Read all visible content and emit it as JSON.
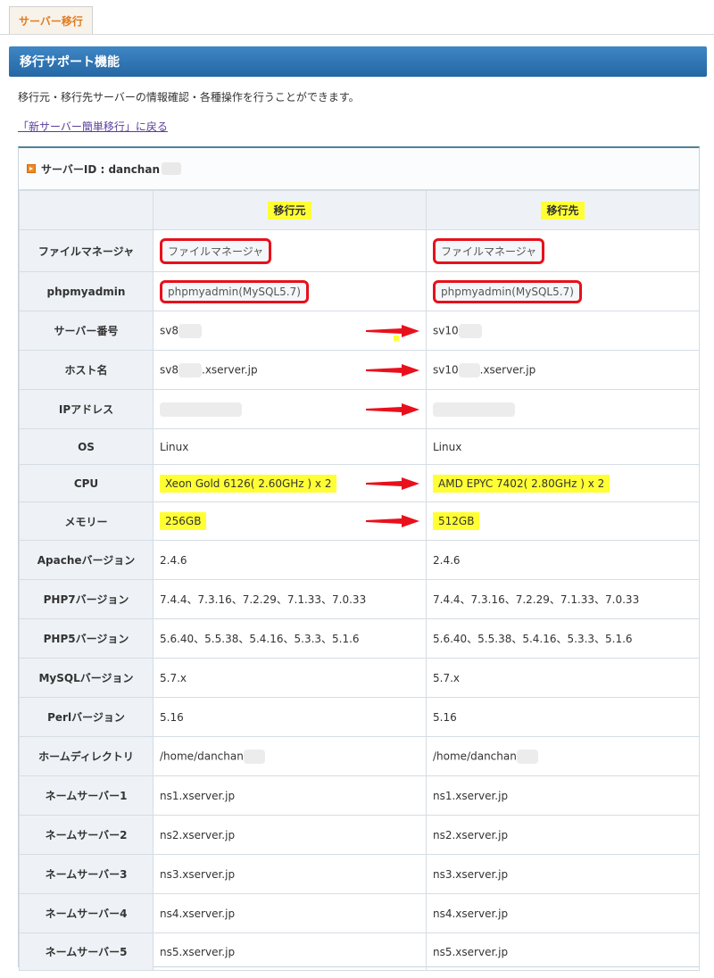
{
  "tab": {
    "label": "サーバー移行"
  },
  "panel": {
    "title": "移行サポート機能"
  },
  "description": "移行元・移行先サーバーの情報確認・各種操作を行うことができます。",
  "back_link": "「新サーバー簡単移行」に戻る",
  "server": {
    "id_label": "サーバーID : danchan"
  },
  "columns": {
    "source": "移行元",
    "destination": "移行先"
  },
  "rows": {
    "filemanager": {
      "label": "ファイルマネージャ",
      "source": "ファイルマネージャ",
      "dest": "ファイルマネージャ"
    },
    "phpmyadmin": {
      "label": "phpmyadmin",
      "source": "phpmyadmin(MySQL5.7)",
      "dest": "phpmyadmin(MySQL5.7)"
    },
    "server_no": {
      "label": "サーバー番号",
      "source": "sv8",
      "dest": "sv10"
    },
    "host": {
      "label": "ホスト名",
      "source_a": "sv8",
      "source_b": ".xserver.jp",
      "dest_a": "sv10",
      "dest_b": ".xserver.jp"
    },
    "ip": {
      "label": "IPアドレス"
    },
    "os": {
      "label": "OS",
      "source": "Linux",
      "dest": "Linux"
    },
    "cpu": {
      "label": "CPU",
      "source": "Xeon Gold 6126( 2.60GHz ) x 2",
      "dest": "AMD EPYC 7402( 2.80GHz ) x 2"
    },
    "memory": {
      "label": "メモリー",
      "source": "256GB",
      "dest": "512GB"
    },
    "apache": {
      "label": "Apacheバージョン",
      "source": "2.4.6",
      "dest": "2.4.6"
    },
    "php7": {
      "label": "PHP7バージョン",
      "source": "7.4.4、7.3.16、7.2.29、7.1.33、7.0.33",
      "dest": "7.4.4、7.3.16、7.2.29、7.1.33、7.0.33"
    },
    "php5": {
      "label": "PHP5バージョン",
      "source": "5.6.40、5.5.38、5.4.16、5.3.3、5.1.6",
      "dest": "5.6.40、5.5.38、5.4.16、5.3.3、5.1.6"
    },
    "mysql": {
      "label": "MySQLバージョン",
      "source": "5.7.x",
      "dest": "5.7.x"
    },
    "perl": {
      "label": "Perlバージョン",
      "source": "5.16",
      "dest": "5.16"
    },
    "home": {
      "label": "ホームディレクトリ",
      "source": "/home/danchan",
      "dest": "/home/danchan"
    },
    "ns1": {
      "label": "ネームサーバー1",
      "source": "ns1.xserver.jp",
      "dest": "ns1.xserver.jp"
    },
    "ns2": {
      "label": "ネームサーバー2",
      "source": "ns2.xserver.jp",
      "dest": "ns2.xserver.jp"
    },
    "ns3": {
      "label": "ネームサーバー3",
      "source": "ns3.xserver.jp",
      "dest": "ns3.xserver.jp"
    },
    "ns4": {
      "label": "ネームサーバー4",
      "source": "ns4.xserver.jp",
      "dest": "ns4.xserver.jp"
    },
    "ns5": {
      "label": "ネームサーバー5",
      "source": "ns5.xserver.jp",
      "dest": "ns5.xserver.jp"
    }
  },
  "colors": {
    "accent_orange": "#e07b20",
    "header_blue": "#2467a5",
    "highlight_yellow": "#ffff33",
    "annotation_red": "#e8101c"
  }
}
